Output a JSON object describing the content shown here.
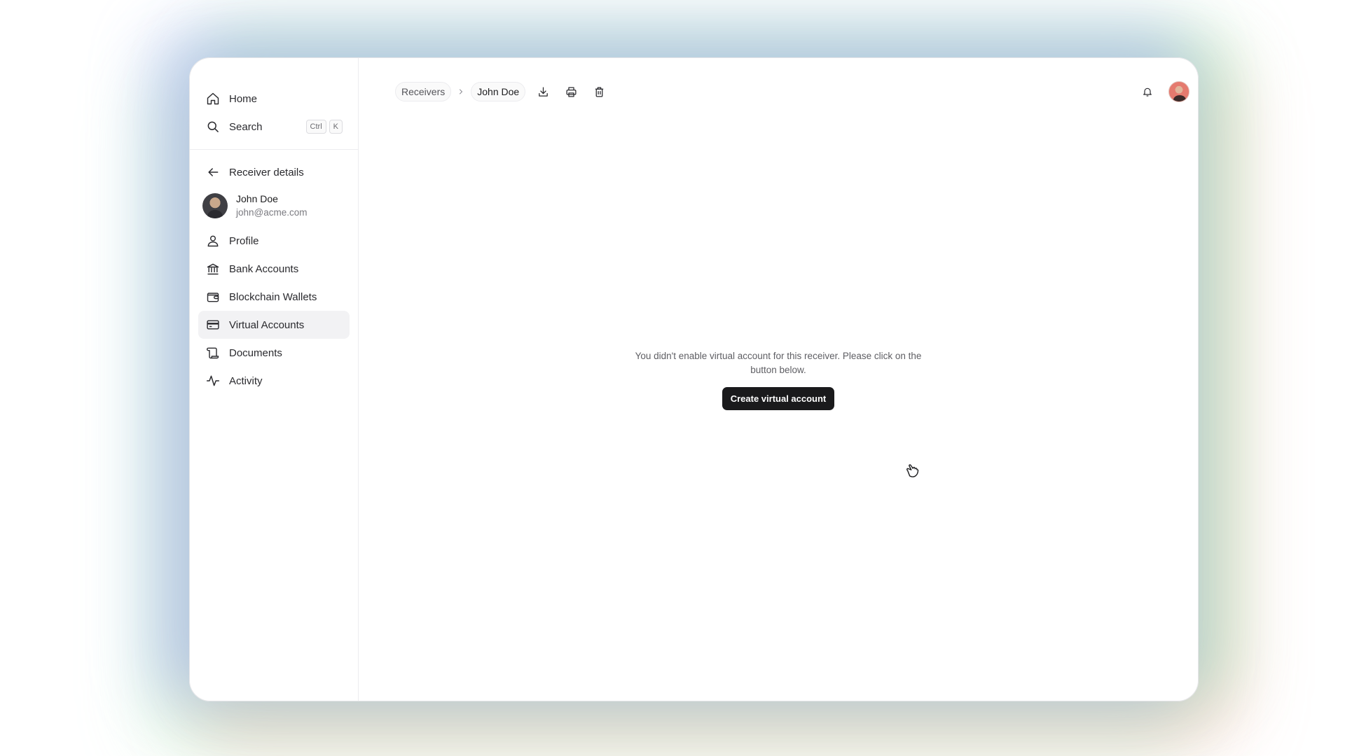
{
  "nav": {
    "home_label": "Home",
    "search_label": "Search",
    "search_shortcut": [
      "Ctrl",
      "K"
    ]
  },
  "receiver": {
    "back_label": "Receiver details",
    "name": "John Doe",
    "email": "john@acme.com"
  },
  "sidebar": {
    "items": [
      {
        "label": "Profile",
        "icon": "user-icon"
      },
      {
        "label": "Bank Accounts",
        "icon": "bank-icon"
      },
      {
        "label": "Blockchain Wallets",
        "icon": "wallet-icon"
      },
      {
        "label": "Virtual Accounts",
        "icon": "credit-card-icon",
        "active": true
      },
      {
        "label": "Documents",
        "icon": "documents-icon"
      },
      {
        "label": "Activity",
        "icon": "activity-icon"
      }
    ]
  },
  "breadcrumb": {
    "parent": "Receivers",
    "current": "John Doe"
  },
  "toolbar": {
    "actions": [
      "download-icon",
      "print-icon",
      "trash-icon"
    ]
  },
  "empty_state": {
    "message": "You didn't enable virtual account for this receiver. Please click on the button below.",
    "button_label": "Create virtual account"
  },
  "colors": {
    "primary_button": "#1a1a1c",
    "active_nav_bg": "#f2f2f4"
  }
}
